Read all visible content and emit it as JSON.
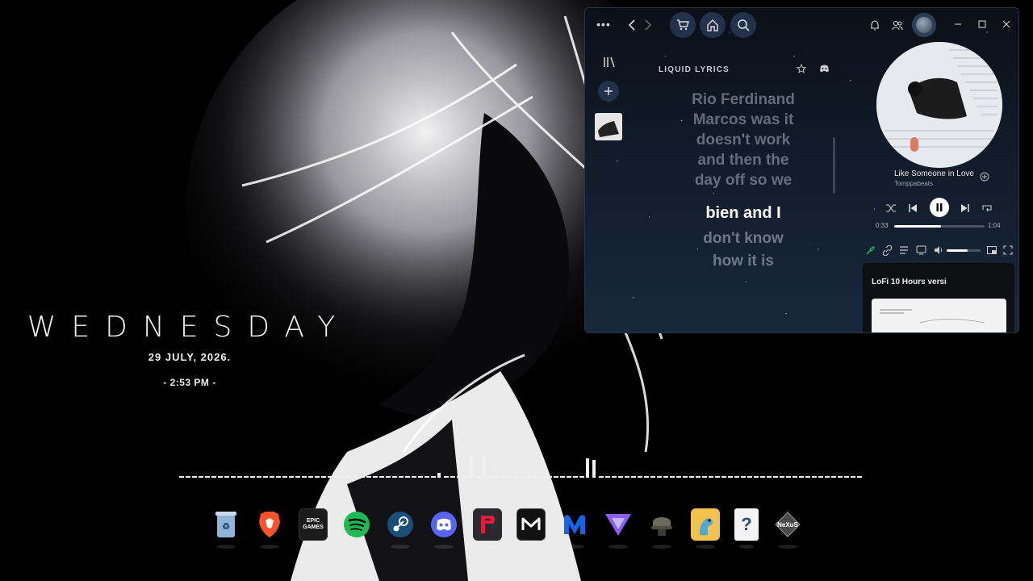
{
  "clock": {
    "day": "WEDNESDAY",
    "date": "29  JULY,  2026.",
    "time": "- 2:53 PM -"
  },
  "dock": {
    "apps": [
      {
        "name": "recycle-bin-icon",
        "label": ""
      },
      {
        "name": "brave-icon",
        "label": ""
      },
      {
        "name": "epic-games-icon",
        "label": "EPIC GAMES"
      },
      {
        "name": "spotify-icon",
        "label": ""
      },
      {
        "name": "steam-icon",
        "label": ""
      },
      {
        "name": "discord-icon",
        "label": ""
      },
      {
        "name": "parsec-icon",
        "label": ""
      },
      {
        "name": "mega-icon",
        "label": ""
      },
      {
        "name": "malwarebytes-icon",
        "label": ""
      },
      {
        "name": "proton-vpn-icon",
        "label": ""
      },
      {
        "name": "pubg-icon",
        "label": ""
      },
      {
        "name": "game-dinosaur-icon",
        "label": ""
      },
      {
        "name": "unknown-file-icon",
        "label": "?"
      },
      {
        "name": "nexus-icon",
        "label": "NeXuS"
      }
    ]
  },
  "spotify": {
    "lyrics_panel_title": "LIQUID LYRICS",
    "lyrics_past": [
      "Rio Ferdinand",
      "Marcos was it",
      "doesn't work",
      "and then the",
      "day off so we"
    ],
    "lyrics_active": "bien and I",
    "lyrics_next": [
      "don't know",
      "how it is"
    ],
    "track": {
      "title": "Like Someone in Love",
      "artist": "Tomppabeats",
      "elapsed": "0:33",
      "duration": "1:04",
      "progress": 0.52
    },
    "volume": 0.62,
    "queue_card_title": "LoFi 10 Hours versi"
  },
  "colors": {
    "accent_green": "#1db954",
    "window_bg": "#111b29"
  }
}
